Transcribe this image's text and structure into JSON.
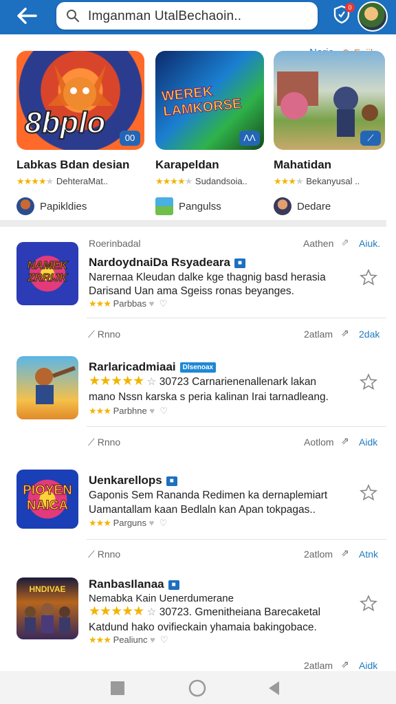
{
  "search": {
    "text": "Imganman UtalBechaoin.."
  },
  "notifications": {
    "count": "0"
  },
  "section": {
    "more_label": "Norie",
    "filter_label": "Fuiik"
  },
  "featured": [
    {
      "art_text": "8bplo",
      "corner": "00",
      "title": "Labkas Bdan desian",
      "meta": "DehteraMat..",
      "developer": "Papikldies",
      "stars": "★★★★",
      "star_off": "★"
    },
    {
      "art_text": "WEREK LAMKORSE",
      "corner": "ΛΛ",
      "title": "Karapeldan",
      "meta": "Sudandsoia..",
      "developer": "Pangulss",
      "stars": "★★★★",
      "star_off": "★"
    },
    {
      "art_text": "",
      "corner": "⟋",
      "title": "Mahatidan",
      "meta": "Bekanyusal ..",
      "developer": "Dedare",
      "stars": "★★★",
      "star_off": "★"
    }
  ],
  "list_header": {
    "label": "Roerinbadal",
    "time": "Aathen",
    "action": "Aiuk."
  },
  "apps": [
    {
      "name": "NardoydnaiDa Rsyadeara",
      "badge": "■",
      "desc1": "Narernaa Kleudan dalke kge thagnig basd herasia",
      "desc2": "Darisand Uan ama Sgeiss ronas beyanges.",
      "meta_stars": "★★★",
      "meta_text": "Parbbas",
      "share": "Rnno",
      "time": "2atlam",
      "action": "2dak",
      "icon_text": "NAMEK ZRRIJK"
    },
    {
      "name": "Rarlaricadmiaai",
      "tag": "Dlsenoax",
      "rating_line": "30723 Carnarienenallenark lakan",
      "desc2": "mano Nssn karska s peria kalinan Irai tarnadleang.",
      "meta_stars": "★★★",
      "meta_text": "Parbhne",
      "share": "Rnno",
      "time": "Aotlom",
      "action": "Aidk",
      "stars": "★★★★★"
    },
    {
      "name": "Uenkarellops",
      "badge": "■",
      "desc1": "Gaponis Sem Ranandа Redimen ka dernaplemiart",
      "desc2": "Uamantallam kaan Bedlaln kan Apan tokpagas..",
      "meta_stars": "★★★",
      "meta_text": "Parguns",
      "share": "Rnno",
      "time": "2atlom",
      "action": "Atnk",
      "icon_text": "PIOYEN NAICA"
    },
    {
      "name": "RanbasIlanaa",
      "badge": "■",
      "sub": "Nemabka Kain Uenerdumerane",
      "rating_line": "30723. Gmenitheiana Barecaketal",
      "desc2": "Katdund hako ovifieckain yhamaia bakingobace.",
      "meta_stars": "★★★",
      "meta_text": "Pealiunc",
      "share": "",
      "time": "2atlam",
      "action": "Aidk",
      "stars": "★★★★★",
      "icon_text": "HNDIVAE"
    }
  ],
  "colors": {
    "topbar": "#1d6fc0",
    "star": "#f2b400",
    "link": "#1d7bc0",
    "filter": "#e2802a"
  }
}
